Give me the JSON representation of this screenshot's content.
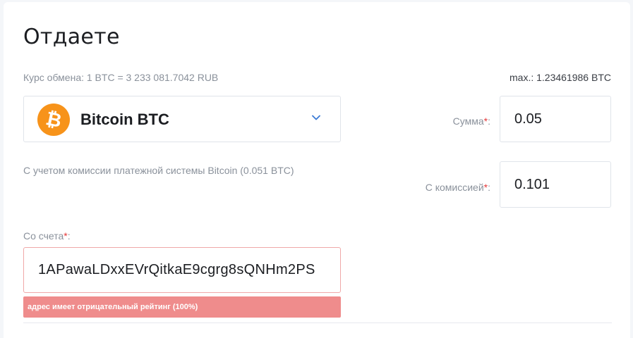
{
  "section": {
    "title": "Отдаете",
    "rate_text": "Курс обмена: 1 BTC = 3 233 081.7042 RUB",
    "max_text": "max.: 1.23461986 BTC"
  },
  "currency": {
    "name": "Bitcoin BTC",
    "icon": "bitcoin-icon",
    "icon_glyph": "₿",
    "icon_color": "#f7931a"
  },
  "sum": {
    "label": "Сумма",
    "required_mark": "*",
    "suffix": ":",
    "value": "0.05"
  },
  "commission": {
    "note": "С учетом комиссии платежной системы Bitcoin (0.051 BTC)",
    "label": "С комиссией",
    "required_mark": "*",
    "suffix": ":",
    "value": "0.101"
  },
  "account": {
    "label": "Со счета",
    "required_mark": "*",
    "suffix": ":",
    "value": "1APawaLDxxEVrQitkaE9cgrg8sQNHm2PS",
    "error": "адрес имеет отрицательный рейтинг (100%)"
  },
  "colors": {
    "error_bg": "#ef8c8c",
    "required": "#e5393a",
    "chevron": "#3b7bd6"
  }
}
